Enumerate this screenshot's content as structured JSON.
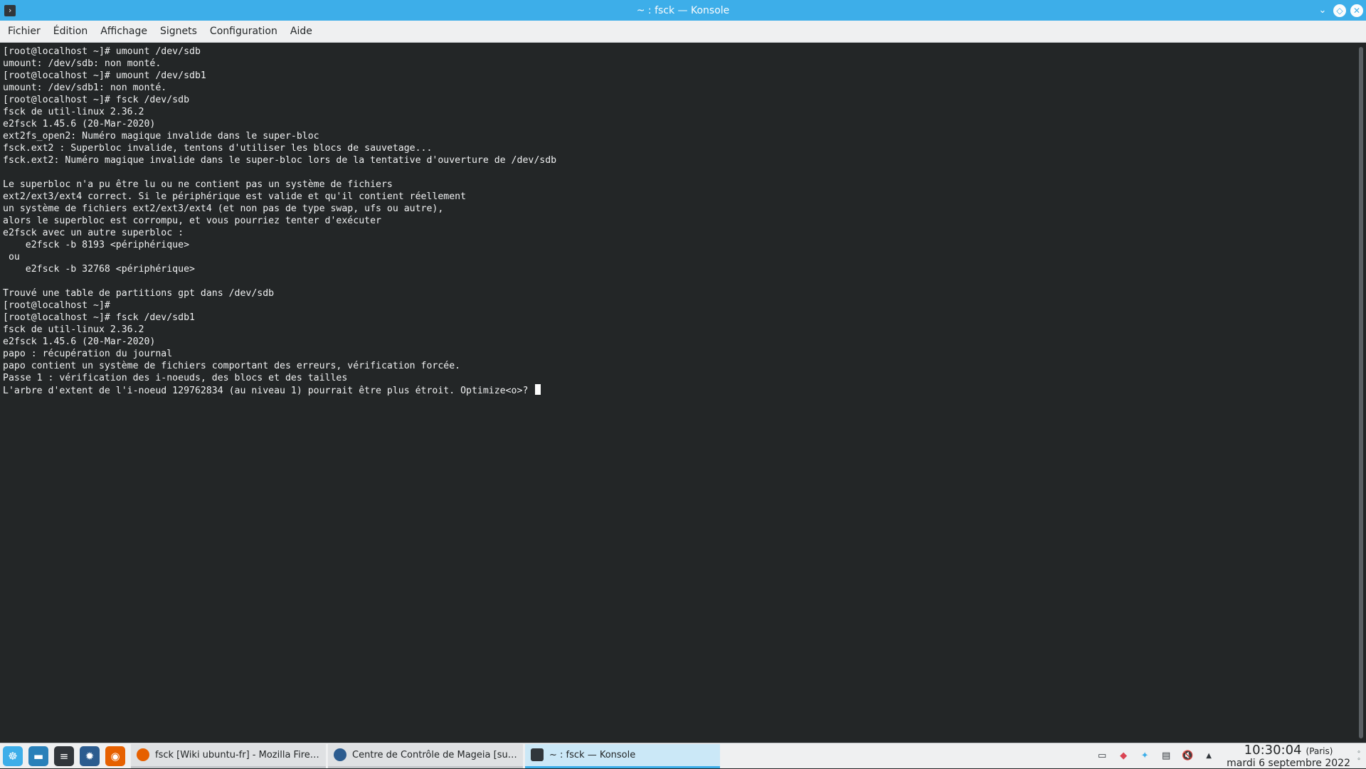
{
  "window": {
    "title": "~ : fsck — Konsole",
    "icon_glyph": "›"
  },
  "menu": {
    "items": [
      "Fichier",
      "Édition",
      "Affichage",
      "Signets",
      "Configuration",
      "Aide"
    ]
  },
  "terminal": {
    "lines": [
      "[root@localhost ~]# umount /dev/sdb",
      "umount: /dev/sdb: non monté.",
      "[root@localhost ~]# umount /dev/sdb1",
      "umount: /dev/sdb1: non monté.",
      "[root@localhost ~]# fsck /dev/sdb",
      "fsck de util-linux 2.36.2",
      "e2fsck 1.45.6 (20-Mar-2020)",
      "ext2fs_open2: Numéro magique invalide dans le super-bloc",
      "fsck.ext2 : Superbloc invalide, tentons d'utiliser les blocs de sauvetage...",
      "fsck.ext2: Numéro magique invalide dans le super-bloc lors de la tentative d'ouverture de /dev/sdb",
      "",
      "Le superbloc n'a pu être lu ou ne contient pas un système de fichiers",
      "ext2/ext3/ext4 correct. Si le périphérique est valide et qu'il contient réellement",
      "un système de fichiers ext2/ext3/ext4 (et non pas de type swap, ufs ou autre),",
      "alors le superbloc est corrompu, et vous pourriez tenter d'exécuter",
      "e2fsck avec un autre superbloc :",
      "    e2fsck -b 8193 <périphérique>",
      " ou",
      "    e2fsck -b 32768 <périphérique>",
      "",
      "Trouvé une table de partitions gpt dans /dev/sdb",
      "[root@localhost ~]#",
      "[root@localhost ~]# fsck /dev/sdb1",
      "fsck de util-linux 2.36.2",
      "e2fsck 1.45.6 (20-Mar-2020)",
      "papo : récupération du journal",
      "papo contient un système de fichiers comportant des erreurs, vérification forcée.",
      "Passe 1 : vérification des i-noeuds, des blocs et des tailles",
      "L'arbre d'extent de l'i-noeud 129762834 (au niveau 1) pourrait être plus étroit. Optimize<o>? "
    ]
  },
  "taskbar": {
    "launchers": [
      {
        "name": "app-launcher-icon",
        "glyph": "☸",
        "color": "#3daee9"
      },
      {
        "name": "file-manager-icon",
        "glyph": "▬",
        "color": "#2980b9"
      },
      {
        "name": "system-settings-icon",
        "glyph": "≡",
        "color": "#31363b"
      },
      {
        "name": "mageia-control-center-icon",
        "glyph": "✹",
        "color": "#2c5c8f"
      },
      {
        "name": "firefox-icon",
        "glyph": "◉",
        "color": "#e66000"
      }
    ],
    "tasks": [
      {
        "label": "fsck [Wiki ubuntu-fr] - Mozilla Firefox",
        "icon_color": "#e66000"
      },
      {
        "label": "Centre de Contrôle de Mageia  [sur local...",
        "icon_color": "#2c5c8f"
      },
      {
        "label": "~ : fsck — Konsole",
        "icon_color": "#31363b"
      }
    ],
    "tray_icons": [
      {
        "name": "show-desktop-icon",
        "glyph": "▭"
      },
      {
        "name": "updates-icon",
        "glyph": "◆"
      },
      {
        "name": "network-icon",
        "glyph": "✦"
      },
      {
        "name": "clipboard-icon",
        "glyph": "▤"
      },
      {
        "name": "volume-muted-icon",
        "glyph": "🔇"
      },
      {
        "name": "expand-tray-icon",
        "glyph": "▲"
      }
    ],
    "clock": {
      "time": "10:30:04",
      "timezone": "(Paris)",
      "date": "mardi 6 septembre 2022"
    }
  },
  "colors": {
    "titlebar": "#3daee9",
    "terminal_bg": "#232627",
    "terminal_fg": "#eff0f1"
  }
}
